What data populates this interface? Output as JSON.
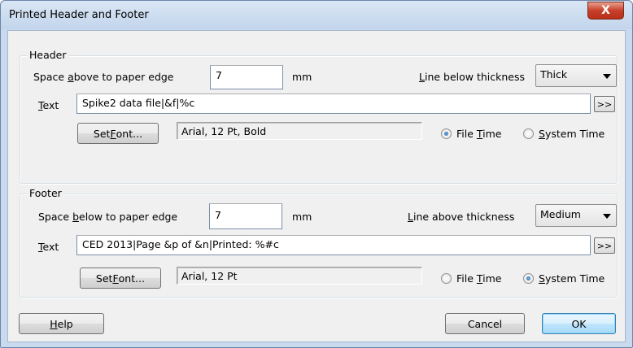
{
  "window": {
    "title": "Printed Header and Footer",
    "close_glyph": "X"
  },
  "header": {
    "group_label": "Header",
    "space_label_pre": "Space ",
    "space_label_accel": "a",
    "space_label_post": "bove to paper edge",
    "space_value": "7",
    "space_unit": "mm",
    "line_label_accel": "L",
    "line_label_post": "ine below thickness",
    "line_value": "Thick",
    "text_label_accel": "T",
    "text_label_post": "ext",
    "text_value": "Spike2 data file|&f|%c",
    "expand_button": ">>",
    "font_btn_pre": "Set ",
    "font_btn_accel": "F",
    "font_btn_post": "ont...",
    "font_value": "Arial, 12 Pt, Bold",
    "radio_file_pre": "File ",
    "radio_file_accel": "T",
    "radio_file_post": "ime",
    "radio_system_accel": "S",
    "radio_system_post": "ystem Time",
    "selected": "file"
  },
  "footer": {
    "group_label": "Footer",
    "space_label_pre": "Space ",
    "space_label_accel": "b",
    "space_label_post": "elow to paper edge",
    "space_value": "7",
    "space_unit": "mm",
    "line_label_accel": "L",
    "line_label_post": "ine above thickness",
    "line_value": "Medium",
    "text_label_accel": "T",
    "text_label_post": "ext",
    "text_value": "CED 2013|Page &p of &n|Printed: %#c",
    "expand_button": ">>",
    "font_btn_pre": "Set ",
    "font_btn_accel": "F",
    "font_btn_post": "ont...",
    "font_value": "Arial, 12 Pt",
    "radio_file_pre": "File ",
    "radio_file_accel": "T",
    "radio_file_post": "ime",
    "radio_system_accel": "S",
    "radio_system_post": "ystem Time",
    "selected": "system"
  },
  "buttons": {
    "help_accel": "H",
    "help_post": "elp",
    "cancel": "Cancel",
    "ok": "OK"
  }
}
